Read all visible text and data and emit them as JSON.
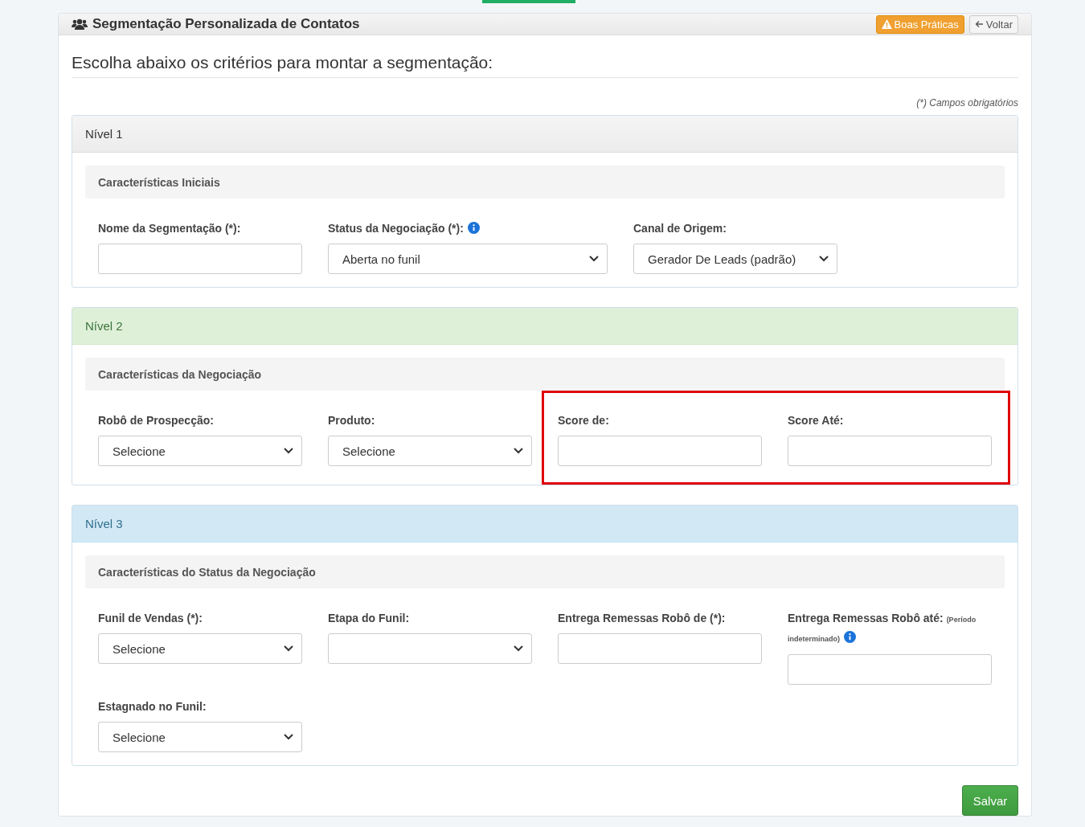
{
  "header": {
    "title": "Segmentação Personalizada de Contatos",
    "buttons": [
      {
        "label": "Boas Práticas",
        "kind": "warning"
      },
      {
        "label": "Voltar",
        "kind": "back"
      }
    ]
  },
  "heading": "Escolha abaixo os critérios para montar a segmentação:",
  "required_note": "(*) Campos obrigatórios",
  "levels": [
    {
      "title": "Nível 1",
      "kind": "default",
      "section": "Características Iniciais",
      "fields": [
        {
          "label": "Nome da Segmentação (*):",
          "kind": "input",
          "info": false
        },
        {
          "label": "Status da Negociação (*):",
          "kind": "select",
          "value": "Aberta no funil",
          "wide": true,
          "info": true
        },
        {
          "label": "Canal de Origem:",
          "kind": "select",
          "value": "Gerador De Leads (padrão)",
          "info": false
        }
      ]
    },
    {
      "title": "Nível 2",
      "kind": "success",
      "section": "Características da Negociação",
      "fields": [
        {
          "label": "Robô de Prospecção:",
          "kind": "select",
          "value": "Selecione",
          "info": false
        },
        {
          "label": "Produto:",
          "kind": "select",
          "value": "Selecione",
          "info": false
        },
        {
          "kind": "highlight_group",
          "fields": [
            {
              "label": "Score de:",
              "kind": "input",
              "info": false
            },
            {
              "label": "Score Até:",
              "kind": "input",
              "info": false
            }
          ]
        }
      ]
    },
    {
      "title": "Nível 3",
      "kind": "info",
      "section": "Características do Status da Negociação",
      "fields": [
        {
          "label": "Funil de Vendas (*):",
          "kind": "select",
          "value": "Selecione",
          "info": false
        },
        {
          "label": "Etapa do Funil:",
          "kind": "select",
          "info": false
        },
        {
          "label": "Entrega Remessas Robô de (*):",
          "kind": "input",
          "info": false
        },
        {
          "label": "Entrega Remessas Robô até:",
          "note": "(Período indeterminado)",
          "kind": "input",
          "info": true
        },
        {
          "label": "Estagnado no Funil:",
          "kind": "select",
          "value": "Selecione",
          "info": false
        }
      ]
    }
  ],
  "save_button": "Salvar"
}
